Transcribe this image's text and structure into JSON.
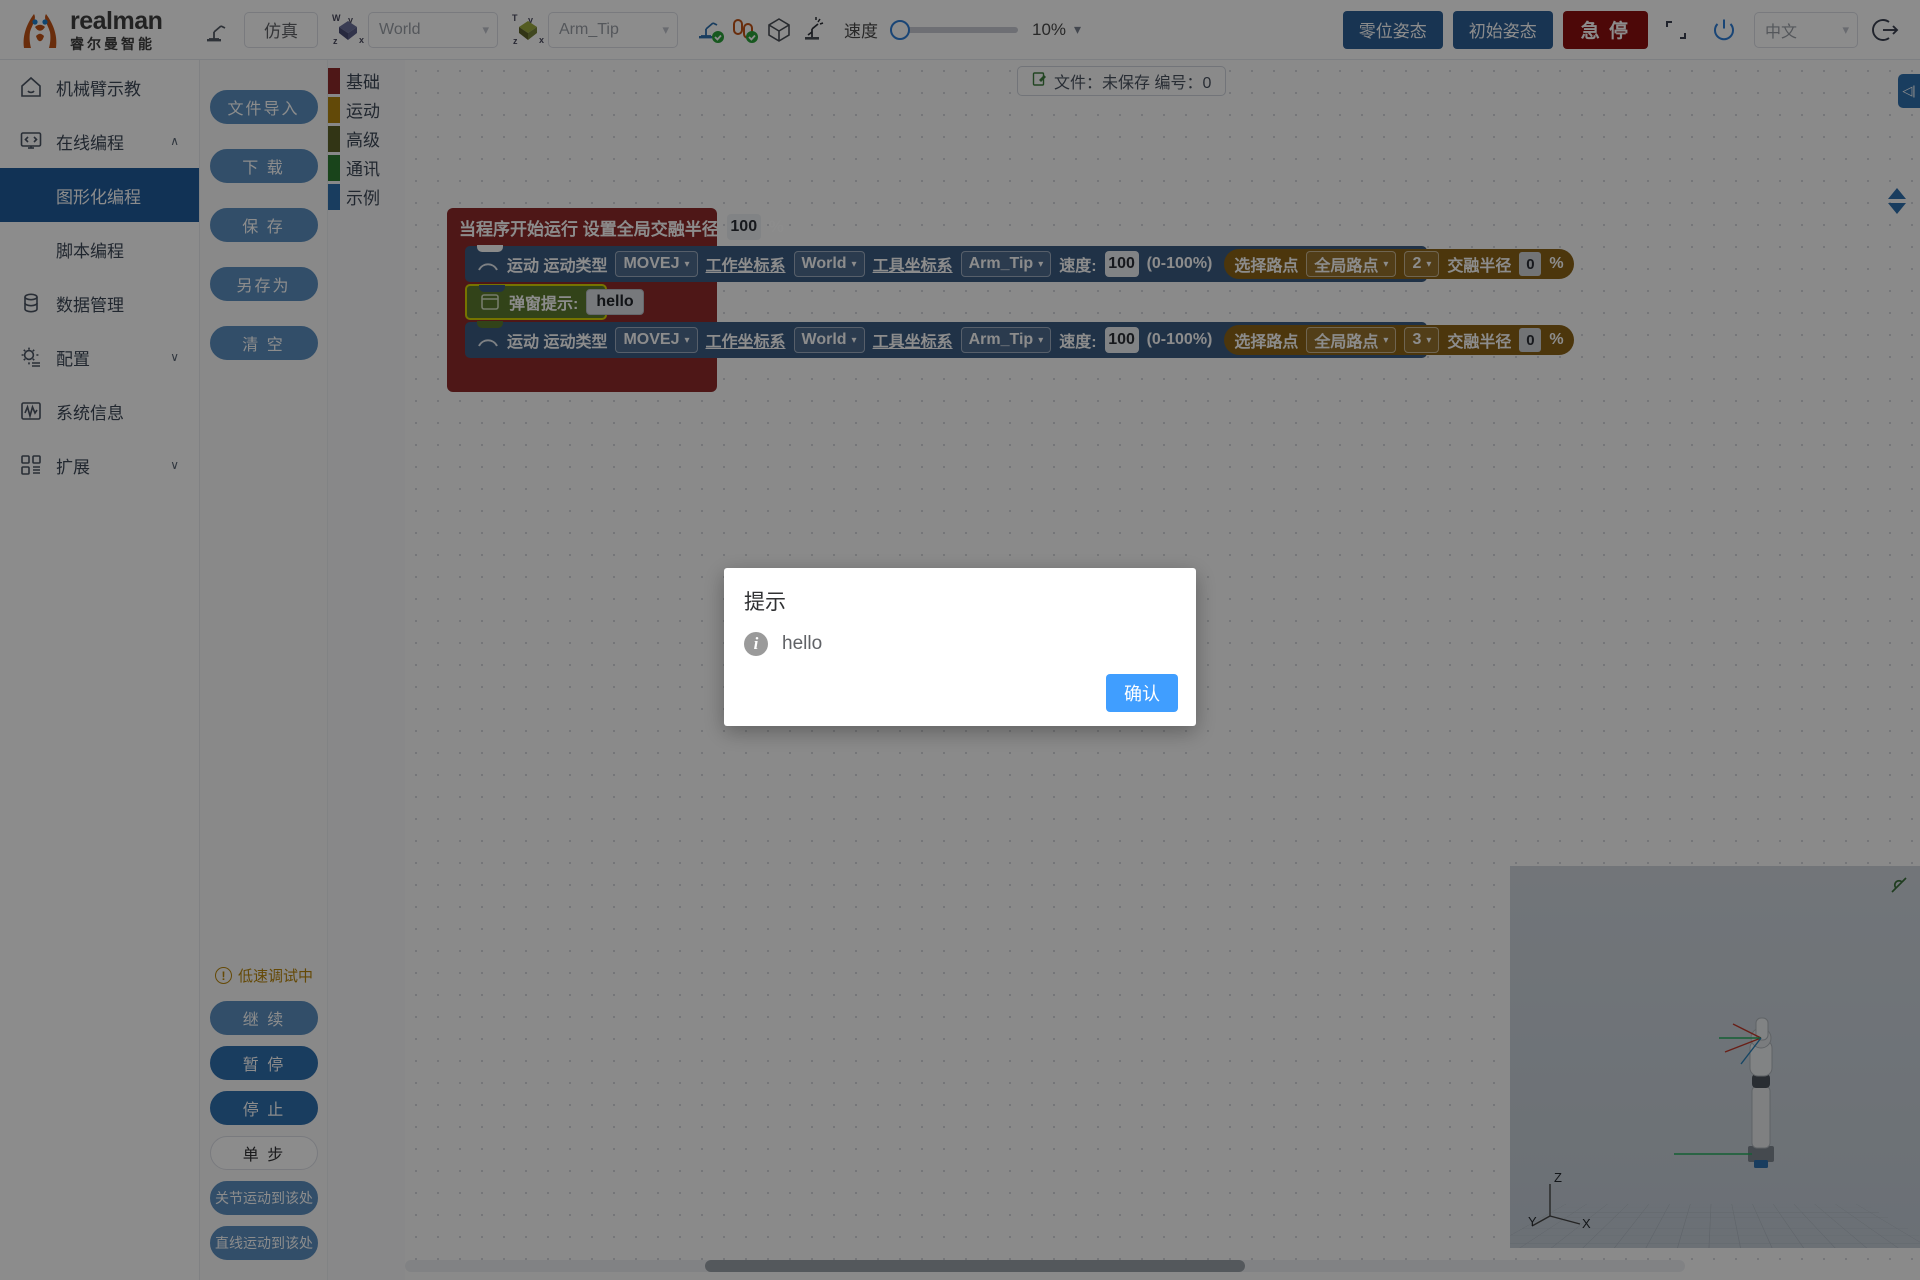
{
  "brand": {
    "name_en": "realman",
    "name_cn": "睿尔曼智能",
    "accent": "#c05316"
  },
  "toolbar": {
    "robot_icon": "robot-arm-icon",
    "sim_label": "仿真",
    "work_frame": {
      "icon": "world-axis-icon",
      "badge": "W",
      "value": "World",
      "placeholder": "World"
    },
    "tool_frame": {
      "icon": "tool-axis-icon",
      "badge": "T",
      "value": "Arm_Tip",
      "placeholder": "Arm_Tip"
    },
    "toggle_icons": [
      "teach-pendant-check-icon",
      "loop-check-icon",
      "cube-icon",
      "collision-icon"
    ],
    "speed_label": "速度",
    "speed_percent": "10%",
    "speed_slider_value": 10,
    "zero_pose_label": "零位姿态",
    "init_pose_label": "初始姿态",
    "estop_label": "急 停",
    "estop_color": "#8c0f0f",
    "fullscreen_icon": "fullscreen-icon",
    "power_icon": "power-icon",
    "language": {
      "value": "中文"
    },
    "logout_icon": "logout-icon"
  },
  "sidebar": {
    "items": [
      {
        "label": "机械臂示教",
        "icon": "home-icon",
        "chev": "",
        "active": false
      },
      {
        "label": "在线编程",
        "icon": "code-monitor-icon",
        "chev": "∧",
        "active": false
      },
      {
        "label": "数据管理",
        "icon": "database-icon",
        "chev": "",
        "active": false
      },
      {
        "label": "配置",
        "icon": "gear-list-icon",
        "chev": "∨",
        "active": false
      },
      {
        "label": "系统信息",
        "icon": "wave-chart-icon",
        "chev": "",
        "active": false
      },
      {
        "label": "扩展",
        "icon": "grid-extension-icon",
        "chev": "∨",
        "active": false
      }
    ],
    "subitems": [
      {
        "label": "图形化编程",
        "active": true
      },
      {
        "label": "脚本编程",
        "active": false
      }
    ]
  },
  "file_panel": {
    "buttons": [
      {
        "label": "文件导入",
        "style": "blue"
      },
      {
        "label": "下 载",
        "style": "blue"
      },
      {
        "label": "保 存",
        "style": "blue"
      },
      {
        "label": "另存为",
        "style": "blue"
      },
      {
        "label": "清 空",
        "style": "blue"
      }
    ],
    "run_status": {
      "icon": "warning-circle-icon",
      "text": "低速调试中",
      "color": "#b8860b"
    },
    "run_buttons": [
      {
        "label": "继 续",
        "style": "blue-light"
      },
      {
        "label": "暂 停",
        "style": "blue"
      },
      {
        "label": "停 止",
        "style": "blue"
      },
      {
        "label": "单 步",
        "style": "ghost"
      },
      {
        "label": "关节运动到该处",
        "style": "blue-light"
      },
      {
        "label": "直线运动到该处",
        "style": "blue-light"
      }
    ]
  },
  "palette": {
    "categories": [
      {
        "label": "基础",
        "color": "#8e2b2b"
      },
      {
        "label": "运动",
        "color": "#b3860f"
      },
      {
        "label": "高级",
        "color": "#5b6227"
      },
      {
        "label": "通讯",
        "color": "#2e7d32"
      },
      {
        "label": "示例",
        "color": "#2f6fae"
      }
    ]
  },
  "workspace": {
    "file_chip": {
      "icon": "file-edit-icon",
      "text": "文件：未保存  编号：0"
    },
    "program": {
      "root": {
        "title": "当程序开始运行  设置全局交融半径",
        "blend_radius": "100",
        "unit": "%",
        "color": "#8e2b2b"
      },
      "blocks": [
        {
          "type": "motion",
          "icon": "arc-motion-icon",
          "label": "运动 运动类型",
          "motion_type": "MOVEJ",
          "work_frame_label": "工作坐标系",
          "work_frame": "World",
          "tool_frame_label": "工具坐标系",
          "tool_frame": "Arm_Tip",
          "speed_label": "速度:",
          "speed": "100",
          "speed_range": "(0-100%)",
          "waypoint_btn": "选择路点",
          "waypoint_scope": "全局路点",
          "waypoint_index": "2",
          "blend_label": "交融半径",
          "blend_radius": "0",
          "unit": "%",
          "color": "#3b5c82"
        },
        {
          "type": "popup",
          "icon": "window-popup-icon",
          "label": "弹窗提示:",
          "message": "hello",
          "color": "#5b7a2e",
          "highlight": "#d8d400"
        },
        {
          "type": "motion",
          "icon": "arc-motion-icon",
          "label": "运动 运动类型",
          "motion_type": "MOVEJ",
          "work_frame_label": "工作坐标系",
          "work_frame": "World",
          "tool_frame_label": "工具坐标系",
          "tool_frame": "Arm_Tip",
          "speed_label": "速度:",
          "speed": "100",
          "speed_range": "(0-100%)",
          "waypoint_btn": "选择路点",
          "waypoint_scope": "全局路点",
          "waypoint_index": "3",
          "blend_label": "交融半径",
          "blend_radius": "0",
          "unit": "%",
          "color": "#3b5c82"
        }
      ]
    },
    "side_handle_icon": "collapse-left-icon",
    "zoom_up_icon": "triangle-up-icon",
    "zoom_down_icon": "triangle-down-icon",
    "preview": {
      "no_collision_icon": "no-collision-icon",
      "axis_labels": {
        "x": "X",
        "y": "Y",
        "z": "Z"
      }
    }
  },
  "dialog": {
    "title": "提示",
    "icon": "info-icon",
    "message": "hello",
    "confirm_label": "确认",
    "confirm_color": "#409eff"
  }
}
